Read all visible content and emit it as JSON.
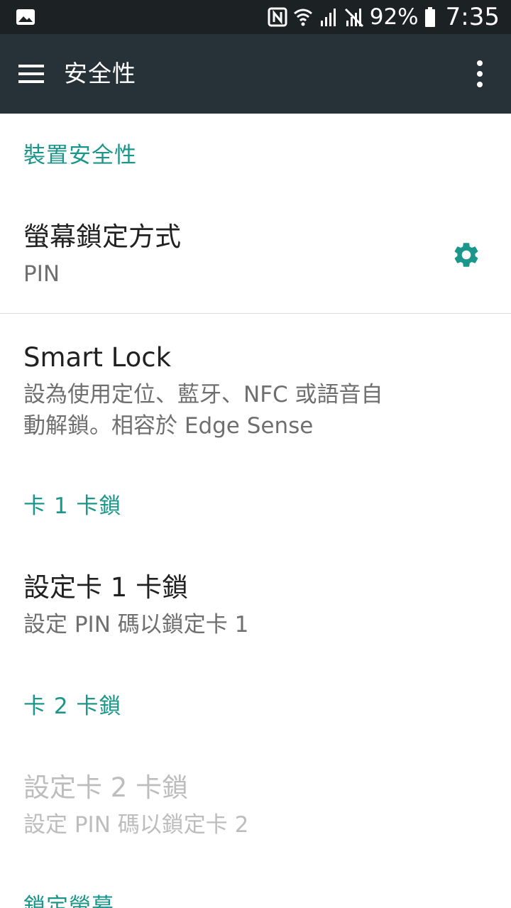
{
  "status_bar": {
    "battery_percent": "92%",
    "time": "7:35",
    "icons": [
      "gallery-icon",
      "nfc-icon",
      "wifi-icon",
      "signal-icon",
      "signal-no-data-icon",
      "battery-icon"
    ]
  },
  "app_bar": {
    "title": "安全性",
    "icons": [
      "menu-icon",
      "overflow-icon"
    ]
  },
  "sections": [
    {
      "header": "裝置安全性",
      "items": [
        {
          "title": "螢幕鎖定方式",
          "subtitle": "PIN",
          "icon": "gear-icon"
        },
        {
          "title": "Smart Lock",
          "subtitle_lines": [
            "設為使用定位、藍牙、NFC 或語音自",
            "動解鎖。相容於 Edge Sense"
          ]
        }
      ]
    },
    {
      "header": "卡 1 卡鎖",
      "items": [
        {
          "title": "設定卡 1 卡鎖",
          "subtitle": "設定 PIN 碼以鎖定卡 1"
        }
      ]
    },
    {
      "header": "卡 2 卡鎖",
      "items": [
        {
          "title": "設定卡 2 卡鎖",
          "subtitle": "設定 PIN 碼以鎖定卡 2",
          "enabled": false
        }
      ]
    },
    {
      "header": "鎖定螢幕",
      "items": []
    }
  ],
  "colors": {
    "status_bar_bg": "#1c2124",
    "app_bar_bg": "#263238",
    "accent": "#1a968a",
    "primary_text": "#212121",
    "secondary_text": "#6f6f6f",
    "disabled_text": "#bdbdbd"
  }
}
